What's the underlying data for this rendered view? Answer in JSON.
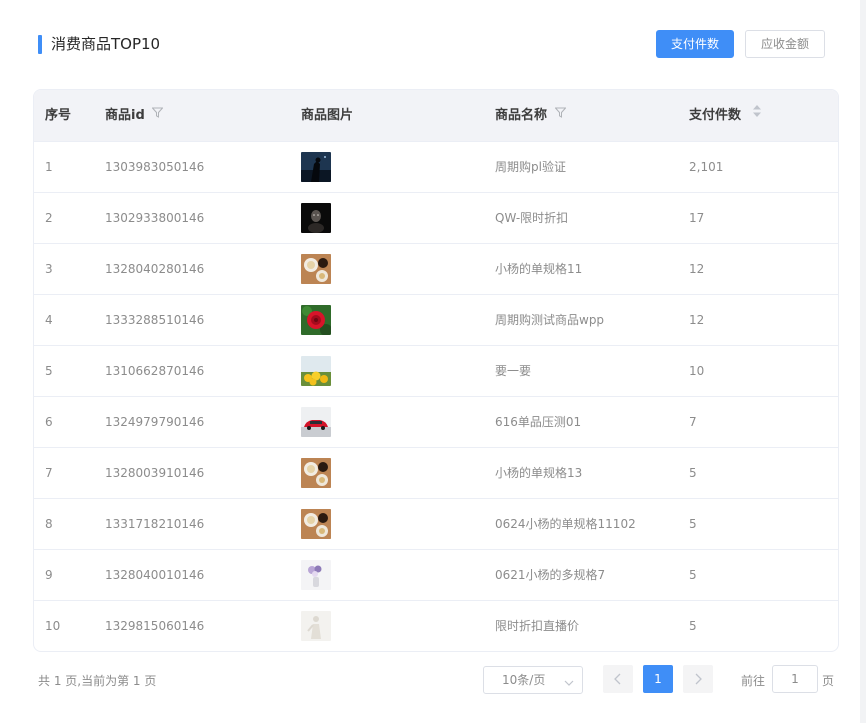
{
  "header": {
    "title": "消费商品TOP10",
    "buttons": [
      {
        "label": "支付件数",
        "active": true
      },
      {
        "label": "应收金额",
        "active": false
      }
    ]
  },
  "table": {
    "columns": [
      {
        "label": "序号",
        "filter": false,
        "sort": false
      },
      {
        "label": "商品id",
        "filter": true,
        "sort": false
      },
      {
        "label": "商品图片",
        "filter": false,
        "sort": false
      },
      {
        "label": "商品名称",
        "filter": true,
        "sort": false
      },
      {
        "label": "支付件数",
        "filter": false,
        "sort": true
      }
    ],
    "rows": [
      {
        "index": "1",
        "id": "1303983050146",
        "image": "night-silhouette-photo",
        "name": "周期购pl验证",
        "count": "2,101"
      },
      {
        "index": "2",
        "id": "1302933800146",
        "image": "dark-portrait-photo",
        "name": "QW-限时折扣",
        "count": "17"
      },
      {
        "index": "3",
        "id": "1328040280146",
        "image": "coffee-food-photo",
        "name": "小杨的单规格11",
        "count": "12"
      },
      {
        "index": "4",
        "id": "1333288510146",
        "image": "red-flower-photo",
        "name": "周期购测试商品wpp",
        "count": "12"
      },
      {
        "index": "5",
        "id": "1310662870146",
        "image": "lemons-field-photo",
        "name": "要一要",
        "count": "10"
      },
      {
        "index": "6",
        "id": "1324979790146",
        "image": "red-car-photo",
        "name": "616单品压测01",
        "count": "7"
      },
      {
        "index": "7",
        "id": "1328003910146",
        "image": "coffee-food-photo",
        "name": "小杨的单规格13",
        "count": "5"
      },
      {
        "index": "8",
        "id": "1331718210146",
        "image": "coffee-food-photo",
        "name": "0624小杨的单规格11102",
        "count": "5"
      },
      {
        "index": "9",
        "id": "1328040010146",
        "image": "flower-vase-photo",
        "name": "0621小杨的多规格7",
        "count": "5"
      },
      {
        "index": "10",
        "id": "1329815060146",
        "image": "white-figure-photo",
        "name": "限时折扣直播价",
        "count": "5"
      }
    ]
  },
  "pagination": {
    "summary": "共 1 页,当前为第 1 页",
    "page_size": "10条/页",
    "current_page": "1",
    "goto_prefix": "前往",
    "goto_value": "1",
    "goto_suffix": "页"
  },
  "colors": {
    "accent": "#3f8ef7",
    "header_bg": "#f2f3f7",
    "text_muted": "#8c8c8c"
  },
  "icons": {
    "filter": "filter-icon",
    "sort": "sort-caret-icon",
    "prev": "chevron-left-icon",
    "next": "chevron-right-icon",
    "dropdown": "chevron-down-icon"
  }
}
